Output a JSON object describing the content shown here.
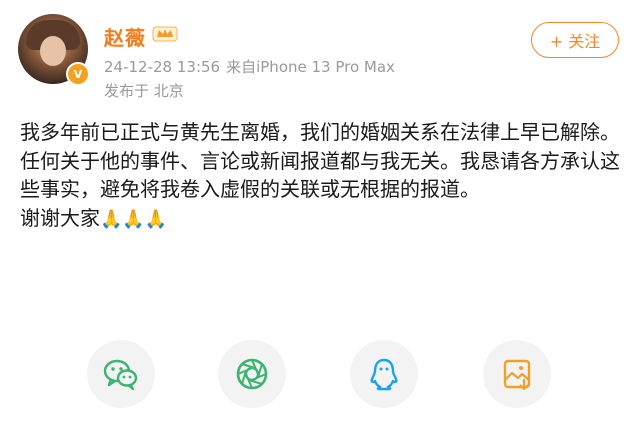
{
  "user": {
    "name": "赵薇",
    "time": "24-12-28 13:56",
    "source": "来自iPhone 13 Pro Max",
    "location": "发布于 北京"
  },
  "actions": {
    "follow_label": "+ 关注"
  },
  "post": {
    "paragraphs": [
      "我多年前已正式与黄先生离婚，我们的婚姻关系在法律上早已解除。",
      "任何关于他的事件、言论或新闻报道都与我无关。我恳请各方承认这些事实，避免将我卷入虚假的关联或无根据的报道。",
      "谢谢大家"
    ],
    "emoji": "🙏🙏🙏"
  },
  "share": {
    "items": [
      "wechat-icon",
      "moments-icon",
      "qq-icon",
      "save-image-icon"
    ]
  },
  "colors": {
    "name": "#f57c1a",
    "follow": "#f28a2b",
    "meta": "#9a9a9a",
    "wechat": "#3cb371",
    "qq": "#1aa3e8",
    "save": "#f0a02a"
  }
}
